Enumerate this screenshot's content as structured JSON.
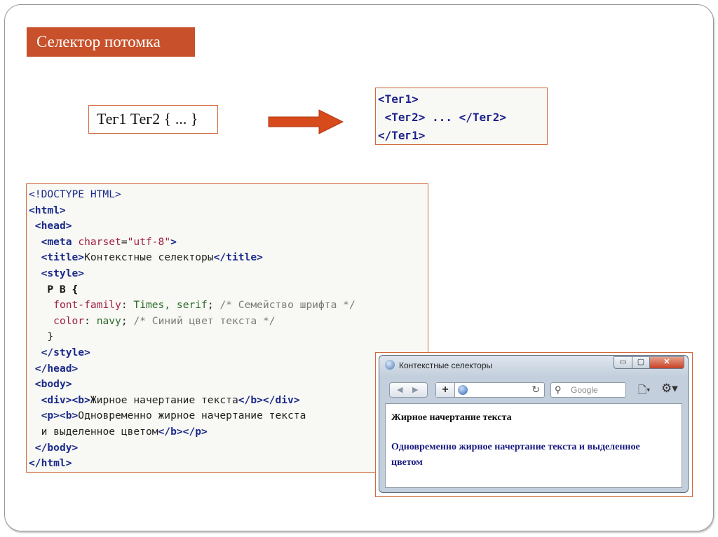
{
  "slide": {
    "title": "Селектор потомка",
    "selector_syntax": "Тег1 Тег2 { ... }",
    "tag_structure": [
      "<Тег1>",
      " <Тег2> ... </Тег2>",
      "</Тег1>"
    ]
  },
  "code": {
    "doctype": "<!DOCTYPE HTML>",
    "html_open": "<html>",
    "head_open": "<head>",
    "meta_tag": "<meta",
    "meta_attr": "charset",
    "meta_eq": "=",
    "meta_val": "\"utf-8\"",
    "meta_close": ">",
    "title_open": "<title>",
    "title_text": "Контекстные селекторы",
    "title_close": "</title>",
    "style_open": "<style>",
    "rule_selector": "P B {",
    "prop1": "font-family",
    "val1": "Times, serif",
    "comment1": "/* Семейство шрифта */",
    "prop2": "color",
    "val2": "navy",
    "comment2": "/* Синий цвет текста */",
    "rule_close": "}",
    "style_close": "</style>",
    "head_close": "</head>",
    "body_open": "<body>",
    "div_b_open": "<div><b>",
    "div_text": "Жирное начертание текста",
    "div_b_close": "</b></div>",
    "p_b_open": "<p><b>",
    "p_text_1": "Одновременно жирное начертание текста",
    "p_text_2": "и выделенное цветом",
    "p_b_close": "</b></p>",
    "body_close": "</body>",
    "html_close": "</html>",
    "colon": ":",
    "semicolon": ";"
  },
  "browser": {
    "window_title": "Контекстные селекторы",
    "minimize_label": "▭",
    "maximize_label": "▢",
    "close_label": "✕",
    "back_icon": "◀",
    "forward_icon": "▶",
    "new_tab_label": "+",
    "reload_icon": "↻",
    "search_placeholder": "Google",
    "page_icon": "🗋▾",
    "tools_icon": "⚙▾",
    "content_line1": "Жирное начертание текста",
    "content_line2": "Одновременно жирное начертание текста и выделенное цветом"
  },
  "colors": {
    "accent": "#c8502a",
    "border": "#d06a3c",
    "tag_text": "#1b1f8c",
    "navy": "#1a1a80"
  }
}
